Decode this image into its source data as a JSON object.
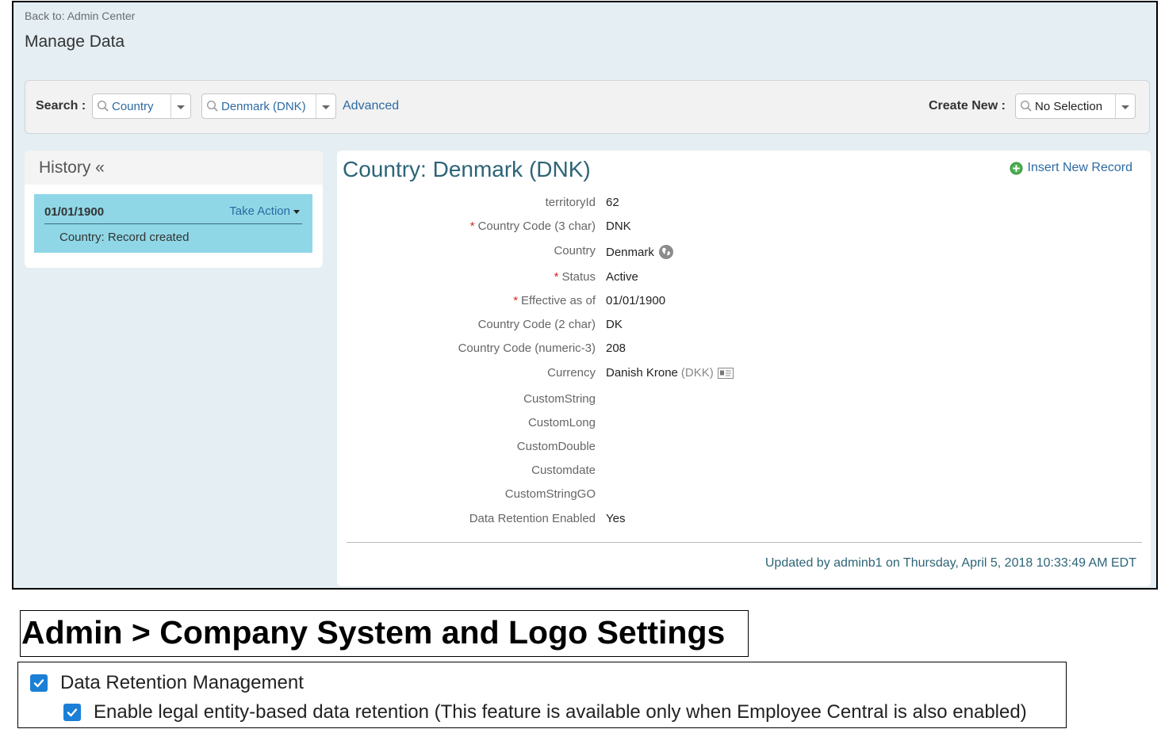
{
  "header": {
    "back_link": "Back to: Admin Center",
    "title": "Manage Data"
  },
  "search": {
    "label": "Search :",
    "object_type": "Country",
    "record": "Denmark (DNK)",
    "advanced_link": "Advanced",
    "create_new_label": "Create New :",
    "create_new_value": "No Selection"
  },
  "history": {
    "title": "History «",
    "entries": [
      {
        "date": "01/01/1900",
        "action_label": "Take Action",
        "description": "Country: Record created"
      }
    ]
  },
  "record": {
    "title": "Country: Denmark (DNK)",
    "insert_new_label": "Insert New Record",
    "fields": [
      {
        "label": "territoryId",
        "required": false,
        "value": "62"
      },
      {
        "label": "Country Code (3 char)",
        "required": true,
        "value": "DNK"
      },
      {
        "label": "Country",
        "required": false,
        "value": "Denmark",
        "icon": "globe-icon"
      },
      {
        "label": "Status",
        "required": true,
        "value": "Active"
      },
      {
        "label": "Effective as of",
        "required": true,
        "value": "01/01/1900"
      },
      {
        "label": "Country Code (2 char)",
        "required": false,
        "value": "DK"
      },
      {
        "label": "Country Code (numeric-3)",
        "required": false,
        "value": "208"
      },
      {
        "label": "Currency",
        "required": false,
        "value": "Danish Krone",
        "value_suffix": "(DKK)",
        "icon": "details-card-icon"
      },
      {
        "label": "CustomString",
        "required": false,
        "value": ""
      },
      {
        "label": "CustomLong",
        "required": false,
        "value": ""
      },
      {
        "label": "CustomDouble",
        "required": false,
        "value": ""
      },
      {
        "label": "Customdate",
        "required": false,
        "value": ""
      },
      {
        "label": "CustomStringGO",
        "required": false,
        "value": ""
      },
      {
        "label": "Data Retention Enabled",
        "required": false,
        "value": "Yes"
      }
    ],
    "updated_text": "Updated by adminb1 on Thursday, April 5, 2018 10:33:49 AM EDT"
  },
  "caption": {
    "text": "Admin > Company System and Logo Settings"
  },
  "settings": {
    "items": [
      {
        "label": "Data Retention Management",
        "checked": true
      },
      {
        "label": "Enable legal entity-based data retention (This feature is available only when Employee Central is also enabled)",
        "checked": true
      }
    ]
  },
  "colors": {
    "page_bg": "#e4eef3",
    "link": "#2d6aa3",
    "title": "#2d6477",
    "history_highlight": "#8fd7e6",
    "required": "#d9261c",
    "checkbox": "#1b7fd6"
  }
}
